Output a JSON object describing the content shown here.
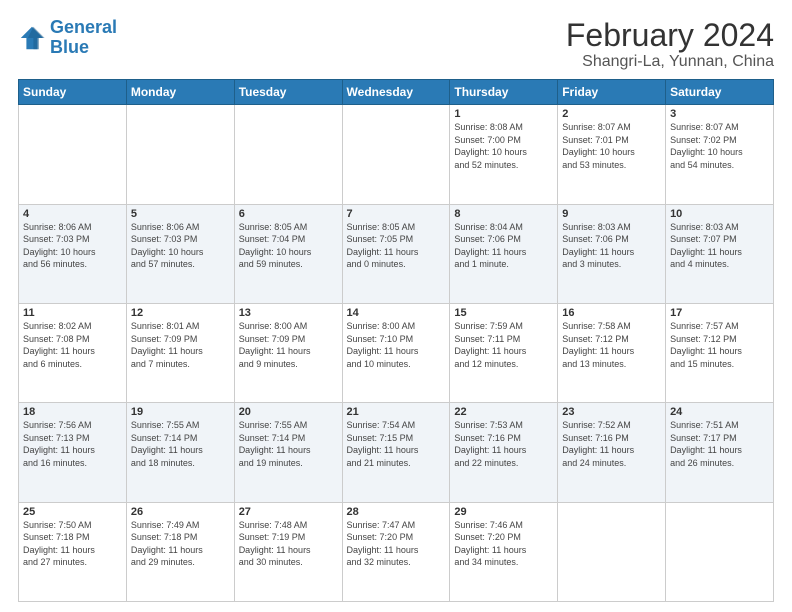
{
  "header": {
    "logo_general": "General",
    "logo_blue": "Blue",
    "title": "February 2024",
    "subtitle": "Shangri-La, Yunnan, China"
  },
  "weekdays": [
    "Sunday",
    "Monday",
    "Tuesday",
    "Wednesday",
    "Thursday",
    "Friday",
    "Saturday"
  ],
  "weeks": [
    [
      {
        "day": "",
        "info": ""
      },
      {
        "day": "",
        "info": ""
      },
      {
        "day": "",
        "info": ""
      },
      {
        "day": "",
        "info": ""
      },
      {
        "day": "1",
        "info": "Sunrise: 8:08 AM\nSunset: 7:00 PM\nDaylight: 10 hours\nand 52 minutes."
      },
      {
        "day": "2",
        "info": "Sunrise: 8:07 AM\nSunset: 7:01 PM\nDaylight: 10 hours\nand 53 minutes."
      },
      {
        "day": "3",
        "info": "Sunrise: 8:07 AM\nSunset: 7:02 PM\nDaylight: 10 hours\nand 54 minutes."
      }
    ],
    [
      {
        "day": "4",
        "info": "Sunrise: 8:06 AM\nSunset: 7:03 PM\nDaylight: 10 hours\nand 56 minutes."
      },
      {
        "day": "5",
        "info": "Sunrise: 8:06 AM\nSunset: 7:03 PM\nDaylight: 10 hours\nand 57 minutes."
      },
      {
        "day": "6",
        "info": "Sunrise: 8:05 AM\nSunset: 7:04 PM\nDaylight: 10 hours\nand 59 minutes."
      },
      {
        "day": "7",
        "info": "Sunrise: 8:05 AM\nSunset: 7:05 PM\nDaylight: 11 hours\nand 0 minutes."
      },
      {
        "day": "8",
        "info": "Sunrise: 8:04 AM\nSunset: 7:06 PM\nDaylight: 11 hours\nand 1 minute."
      },
      {
        "day": "9",
        "info": "Sunrise: 8:03 AM\nSunset: 7:06 PM\nDaylight: 11 hours\nand 3 minutes."
      },
      {
        "day": "10",
        "info": "Sunrise: 8:03 AM\nSunset: 7:07 PM\nDaylight: 11 hours\nand 4 minutes."
      }
    ],
    [
      {
        "day": "11",
        "info": "Sunrise: 8:02 AM\nSunset: 7:08 PM\nDaylight: 11 hours\nand 6 minutes."
      },
      {
        "day": "12",
        "info": "Sunrise: 8:01 AM\nSunset: 7:09 PM\nDaylight: 11 hours\nand 7 minutes."
      },
      {
        "day": "13",
        "info": "Sunrise: 8:00 AM\nSunset: 7:09 PM\nDaylight: 11 hours\nand 9 minutes."
      },
      {
        "day": "14",
        "info": "Sunrise: 8:00 AM\nSunset: 7:10 PM\nDaylight: 11 hours\nand 10 minutes."
      },
      {
        "day": "15",
        "info": "Sunrise: 7:59 AM\nSunset: 7:11 PM\nDaylight: 11 hours\nand 12 minutes."
      },
      {
        "day": "16",
        "info": "Sunrise: 7:58 AM\nSunset: 7:12 PM\nDaylight: 11 hours\nand 13 minutes."
      },
      {
        "day": "17",
        "info": "Sunrise: 7:57 AM\nSunset: 7:12 PM\nDaylight: 11 hours\nand 15 minutes."
      }
    ],
    [
      {
        "day": "18",
        "info": "Sunrise: 7:56 AM\nSunset: 7:13 PM\nDaylight: 11 hours\nand 16 minutes."
      },
      {
        "day": "19",
        "info": "Sunrise: 7:55 AM\nSunset: 7:14 PM\nDaylight: 11 hours\nand 18 minutes."
      },
      {
        "day": "20",
        "info": "Sunrise: 7:55 AM\nSunset: 7:14 PM\nDaylight: 11 hours\nand 19 minutes."
      },
      {
        "day": "21",
        "info": "Sunrise: 7:54 AM\nSunset: 7:15 PM\nDaylight: 11 hours\nand 21 minutes."
      },
      {
        "day": "22",
        "info": "Sunrise: 7:53 AM\nSunset: 7:16 PM\nDaylight: 11 hours\nand 22 minutes."
      },
      {
        "day": "23",
        "info": "Sunrise: 7:52 AM\nSunset: 7:16 PM\nDaylight: 11 hours\nand 24 minutes."
      },
      {
        "day": "24",
        "info": "Sunrise: 7:51 AM\nSunset: 7:17 PM\nDaylight: 11 hours\nand 26 minutes."
      }
    ],
    [
      {
        "day": "25",
        "info": "Sunrise: 7:50 AM\nSunset: 7:18 PM\nDaylight: 11 hours\nand 27 minutes."
      },
      {
        "day": "26",
        "info": "Sunrise: 7:49 AM\nSunset: 7:18 PM\nDaylight: 11 hours\nand 29 minutes."
      },
      {
        "day": "27",
        "info": "Sunrise: 7:48 AM\nSunset: 7:19 PM\nDaylight: 11 hours\nand 30 minutes."
      },
      {
        "day": "28",
        "info": "Sunrise: 7:47 AM\nSunset: 7:20 PM\nDaylight: 11 hours\nand 32 minutes."
      },
      {
        "day": "29",
        "info": "Sunrise: 7:46 AM\nSunset: 7:20 PM\nDaylight: 11 hours\nand 34 minutes."
      },
      {
        "day": "",
        "info": ""
      },
      {
        "day": "",
        "info": ""
      }
    ]
  ]
}
